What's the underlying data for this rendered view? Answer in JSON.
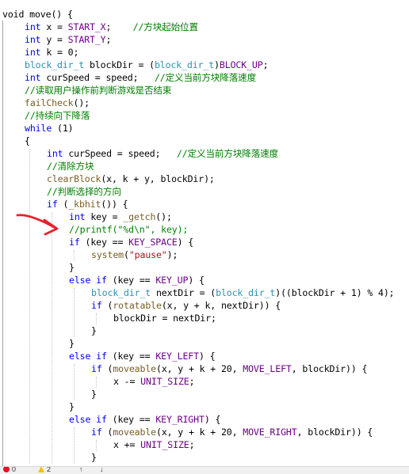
{
  "editor": {
    "language": "C",
    "lines": [
      {
        "indent": 0,
        "tokens": [
          [
            "plain",
            "void move() {"
          ]
        ]
      },
      {
        "indent": 1,
        "tokens": [
          [
            "kw",
            "int"
          ],
          [
            "plain",
            " x = "
          ],
          [
            "mac",
            "START_X"
          ],
          [
            "plain",
            ";    "
          ],
          [
            "cm",
            "//方块起始位置"
          ]
        ]
      },
      {
        "indent": 1,
        "tokens": [
          [
            "kw",
            "int"
          ],
          [
            "plain",
            " y = "
          ],
          [
            "mac",
            "START_Y"
          ],
          [
            "plain",
            ";"
          ]
        ]
      },
      {
        "indent": 1,
        "tokens": [
          [
            "kw",
            "int"
          ],
          [
            "plain",
            " k = 0;"
          ]
        ]
      },
      {
        "indent": 1,
        "tokens": [
          [
            "ty",
            "block_dir_t"
          ],
          [
            "plain",
            " blockDir = ("
          ],
          [
            "ty",
            "block_dir_t"
          ],
          [
            "plain",
            ")"
          ],
          [
            "mac",
            "BLOCK_UP"
          ],
          [
            "plain",
            ";"
          ]
        ]
      },
      {
        "indent": 1,
        "tokens": [
          [
            "kw",
            "int"
          ],
          [
            "plain",
            " curSpeed = speed;   "
          ],
          [
            "cm",
            "//定义当前方块降落速度"
          ]
        ]
      },
      {
        "indent": 1,
        "tokens": [
          [
            "cm",
            "//读取用户操作前判断游戏是否结束"
          ]
        ]
      },
      {
        "indent": 1,
        "tokens": [
          [
            "fn",
            "failCheck"
          ],
          [
            "plain",
            "();"
          ]
        ]
      },
      {
        "indent": 1,
        "tokens": [
          [
            "cm",
            "//持续向下降落"
          ]
        ]
      },
      {
        "indent": 1,
        "tokens": [
          [
            "kw",
            "while"
          ],
          [
            "plain",
            " (1)"
          ]
        ]
      },
      {
        "indent": 1,
        "tokens": [
          [
            "plain",
            "{"
          ]
        ]
      },
      {
        "indent": 2,
        "tokens": [
          [
            "kw",
            "int"
          ],
          [
            "plain",
            " curSpeed = speed;   "
          ],
          [
            "cm",
            "//定义当前方块降落速度"
          ]
        ]
      },
      {
        "indent": 2,
        "tokens": [
          [
            "cm",
            "//清除方块"
          ]
        ]
      },
      {
        "indent": 2,
        "tokens": [
          [
            "fn",
            "clearBlock"
          ],
          [
            "plain",
            "(x, k + y, blockDir);"
          ]
        ]
      },
      {
        "indent": 2,
        "tokens": [
          [
            "cm",
            "//判断选择的方向"
          ]
        ]
      },
      {
        "indent": 2,
        "tokens": [
          [
            "kw",
            "if"
          ],
          [
            "plain",
            " ("
          ],
          [
            "fn",
            "_kbhit"
          ],
          [
            "plain",
            "()) {"
          ]
        ]
      },
      {
        "indent": 3,
        "tokens": [
          [
            "kw",
            "int"
          ],
          [
            "plain",
            " key = "
          ],
          [
            "fn",
            "_getch"
          ],
          [
            "plain",
            "();"
          ]
        ]
      },
      {
        "indent": 3,
        "tokens": [
          [
            "cm",
            "//printf(\"%d\\n\", key);"
          ]
        ]
      },
      {
        "indent": 3,
        "tokens": [
          [
            "kw",
            "if"
          ],
          [
            "plain",
            " (key == "
          ],
          [
            "mac",
            "KEY_SPACE"
          ],
          [
            "plain",
            ") {"
          ]
        ]
      },
      {
        "indent": 4,
        "tokens": [
          [
            "fn",
            "system"
          ],
          [
            "plain",
            "("
          ],
          [
            "str",
            "\"pause\""
          ],
          [
            "plain",
            ");"
          ]
        ]
      },
      {
        "indent": 3,
        "tokens": [
          [
            "plain",
            "}"
          ]
        ]
      },
      {
        "indent": 3,
        "tokens": [
          [
            "kw",
            "else"
          ],
          [
            "plain",
            " "
          ],
          [
            "kw",
            "if"
          ],
          [
            "plain",
            " (key == "
          ],
          [
            "mac",
            "KEY_UP"
          ],
          [
            "plain",
            ") {"
          ]
        ]
      },
      {
        "indent": 4,
        "tokens": [
          [
            "ty",
            "block_dir_t"
          ],
          [
            "plain",
            " nextDir = ("
          ],
          [
            "ty",
            "block_dir_t"
          ],
          [
            "plain",
            ")((blockDir + 1) % 4);"
          ]
        ]
      },
      {
        "indent": 4,
        "tokens": [
          [
            "kw",
            "if"
          ],
          [
            "plain",
            " ("
          ],
          [
            "fn",
            "rotatable"
          ],
          [
            "plain",
            "(x, y + k, nextDir)) {"
          ]
        ]
      },
      {
        "indent": 5,
        "tokens": [
          [
            "plain",
            "blockDir = nextDir;"
          ]
        ]
      },
      {
        "indent": 4,
        "tokens": [
          [
            "plain",
            "}"
          ]
        ]
      },
      {
        "indent": 3,
        "tokens": [
          [
            "plain",
            "}"
          ]
        ]
      },
      {
        "indent": 3,
        "tokens": [
          [
            "kw",
            "else"
          ],
          [
            "plain",
            " "
          ],
          [
            "kw",
            "if"
          ],
          [
            "plain",
            " (key == "
          ],
          [
            "mac",
            "KEY_LEFT"
          ],
          [
            "plain",
            ") {"
          ]
        ]
      },
      {
        "indent": 4,
        "tokens": [
          [
            "kw",
            "if"
          ],
          [
            "plain",
            " ("
          ],
          [
            "fn",
            "moveable"
          ],
          [
            "plain",
            "(x, y + k + 20, "
          ],
          [
            "mac",
            "MOVE_LEFT"
          ],
          [
            "plain",
            ", blockDir)) {"
          ]
        ]
      },
      {
        "indent": 5,
        "tokens": [
          [
            "plain",
            "x -= "
          ],
          [
            "mac",
            "UNIT_SIZE"
          ],
          [
            "plain",
            ";"
          ]
        ]
      },
      {
        "indent": 4,
        "tokens": [
          [
            "plain",
            "}"
          ]
        ]
      },
      {
        "indent": 3,
        "tokens": [
          [
            "plain",
            "}"
          ]
        ]
      },
      {
        "indent": 3,
        "tokens": [
          [
            "kw",
            "else"
          ],
          [
            "plain",
            " "
          ],
          [
            "kw",
            "if"
          ],
          [
            "plain",
            " (key == "
          ],
          [
            "mac",
            "KEY_RIGHT"
          ],
          [
            "plain",
            ") {"
          ]
        ]
      },
      {
        "indent": 4,
        "tokens": [
          [
            "kw",
            "if"
          ],
          [
            "plain",
            " ("
          ],
          [
            "fn",
            "moveable"
          ],
          [
            "plain",
            "(x, y + k + 20, "
          ],
          [
            "mac",
            "MOVE_RIGHT"
          ],
          [
            "plain",
            ", blockDir)) {"
          ]
        ]
      },
      {
        "indent": 5,
        "tokens": [
          [
            "plain",
            "x += "
          ],
          [
            "mac",
            "UNIT_SIZE"
          ],
          [
            "plain",
            ";"
          ]
        ]
      },
      {
        "indent": 4,
        "tokens": [
          [
            "plain",
            "}"
          ]
        ]
      }
    ]
  },
  "statusbar": {
    "errors": "0",
    "warnings": "2",
    "error_icon": "error-circle-icon",
    "warning_icon": "warning-triangle-icon",
    "up_icon": "arrow-up-icon",
    "down_icon": "arrow-down-icon"
  },
  "colors": {
    "keyword": "#0000ff",
    "type": "#2b91af",
    "macro": "#6f008a",
    "string": "#a31515",
    "comment": "#008000",
    "function": "#795e26",
    "annotation_arrow": "#e8202a"
  },
  "annotation": {
    "shape": "red-hand-drawn-arrow",
    "points_to_line": 18
  }
}
